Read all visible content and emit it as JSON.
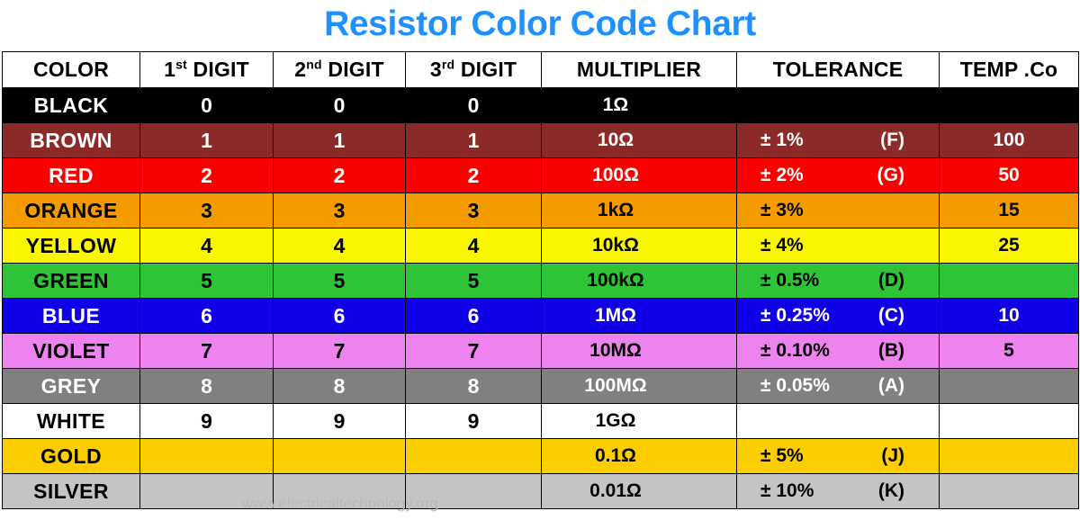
{
  "title": "Resistor Color Code Chart",
  "title_color": "#1E90FF",
  "watermark": {
    "url_text": "www.electricaltechnology.org",
    "shape": "light-bulb-with-resistors"
  },
  "table": {
    "headers": [
      {
        "label": "COLOR",
        "sup": ""
      },
      {
        "label": "1",
        "sup": "st",
        "suffix": " DIGIT"
      },
      {
        "label": "2",
        "sup": "nd",
        "suffix": " DIGIT"
      },
      {
        "label": "3",
        "sup": "rd",
        "suffix": " DIGIT"
      },
      {
        "label": "MULTIPLIER",
        "sup": ""
      },
      {
        "label": "TOLERANCE",
        "sup": ""
      },
      {
        "label": "TEMP .Co",
        "sup": ""
      }
    ],
    "rows": [
      {
        "color_name": "BLACK",
        "swatch": "#000000",
        "text_color": "#ffffff",
        "digit1": "0",
        "digit2": "0",
        "digit3": "0",
        "multiplier": "1Ω",
        "tolerance": "",
        "tolerance_code": "",
        "temp_co": ""
      },
      {
        "color_name": "BROWN",
        "swatch": "#8C2A2A",
        "text_color": "#ffffff",
        "digit1": "1",
        "digit2": "1",
        "digit3": "1",
        "multiplier": "10Ω",
        "tolerance": "± 1%",
        "tolerance_code": "(F)",
        "temp_co": "100"
      },
      {
        "color_name": "RED",
        "swatch": "#FC0000",
        "text_color": "#ffffff",
        "digit1": "2",
        "digit2": "2",
        "digit3": "2",
        "multiplier": "100Ω",
        "tolerance": "± 2%",
        "tolerance_code": "(G)",
        "temp_co": "50"
      },
      {
        "color_name": "ORANGE",
        "swatch": "#F49B00",
        "text_color": "#000000",
        "digit1": "3",
        "digit2": "3",
        "digit3": "3",
        "multiplier": "1kΩ",
        "tolerance": "± 3%",
        "tolerance_code": "",
        "temp_co": "15"
      },
      {
        "color_name": "YELLOW",
        "swatch": "#FAF500",
        "text_color": "#000000",
        "digit1": "4",
        "digit2": "4",
        "digit3": "4",
        "multiplier": "10kΩ",
        "tolerance": "± 4%",
        "tolerance_code": "",
        "temp_co": "25"
      },
      {
        "color_name": "GREEN",
        "swatch": "#2FC438",
        "text_color": "#000000",
        "digit1": "5",
        "digit2": "5",
        "digit3": "5",
        "multiplier": "100kΩ",
        "tolerance": "± 0.5%",
        "tolerance_code": "(D)",
        "temp_co": ""
      },
      {
        "color_name": "BLUE",
        "swatch": "#1000E8",
        "text_color": "#ffffff",
        "digit1": "6",
        "digit2": "6",
        "digit3": "6",
        "multiplier": "1MΩ",
        "tolerance": "± 0.25%",
        "tolerance_code": "(C)",
        "temp_co": "10"
      },
      {
        "color_name": "VIOLET",
        "swatch": "#EE82EE",
        "text_color": "#000000",
        "digit1": "7",
        "digit2": "7",
        "digit3": "7",
        "multiplier": "10MΩ",
        "tolerance": "± 0.10%",
        "tolerance_code": "(B)",
        "temp_co": "5"
      },
      {
        "color_name": "GREY",
        "swatch": "#808080",
        "text_color": "#ffffff",
        "digit1": "8",
        "digit2": "8",
        "digit3": "8",
        "multiplier": "100MΩ",
        "tolerance": "± 0.05%",
        "tolerance_code": "(A)",
        "temp_co": ""
      },
      {
        "color_name": "WHITE",
        "swatch": "#ffffff",
        "text_color": "#000000",
        "digit1": "9",
        "digit2": "9",
        "digit3": "9",
        "multiplier": "1GΩ",
        "tolerance": "",
        "tolerance_code": "",
        "temp_co": ""
      },
      {
        "color_name": "GOLD",
        "swatch": "#FCCE00",
        "text_color": "#000000",
        "digit1": "",
        "digit2": "",
        "digit3": "",
        "multiplier": "0.1Ω",
        "tolerance": "± 5%",
        "tolerance_code": "(J)",
        "temp_co": ""
      },
      {
        "color_name": "SILVER",
        "swatch": "#C4C4C4",
        "text_color": "#000000",
        "digit1": "",
        "digit2": "",
        "digit3": "",
        "multiplier": "0.01Ω",
        "tolerance": "± 10%",
        "tolerance_code": "(K)",
        "temp_co": ""
      }
    ]
  }
}
